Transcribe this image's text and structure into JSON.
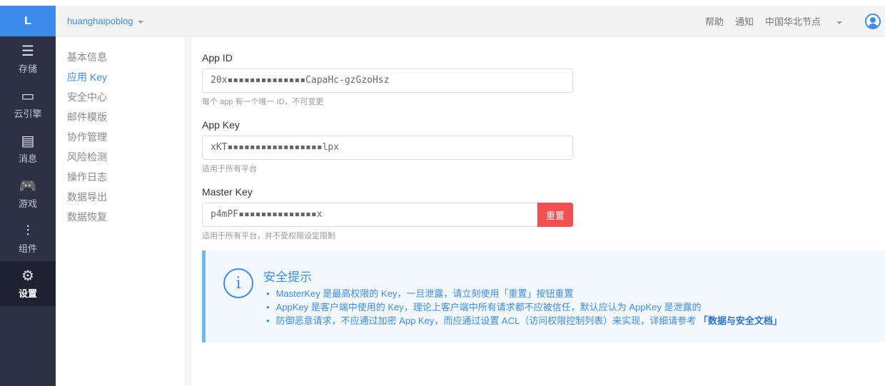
{
  "logo": "L",
  "header": {
    "app_name": "huanghaipoblog",
    "help": "帮助",
    "notify": "通知",
    "region": "中国华北节点"
  },
  "sidebar": [
    {
      "icon": "database-icon",
      "glyph": "☰",
      "label": "存储"
    },
    {
      "icon": "server-icon",
      "glyph": "▭",
      "label": "云引擎"
    },
    {
      "icon": "message-icon",
      "glyph": "▤",
      "label": "消息"
    },
    {
      "icon": "gamepad-icon",
      "glyph": "🎮",
      "label": "游戏"
    },
    {
      "icon": "components-icon",
      "glyph": "⫶",
      "label": "组件"
    },
    {
      "icon": "gear-icon",
      "glyph": "⚙",
      "label": "设置"
    }
  ],
  "subnav": [
    "基本信息",
    "应用 Key",
    "安全中心",
    "邮件模版",
    "协作管理",
    "风险检测",
    "操作日志",
    "数据导出",
    "数据恢复"
  ],
  "form": {
    "app_id": {
      "label": "App ID",
      "value": "20x▪▪▪▪▪▪▪▪▪▪▪▪▪▪CapaHc-gzGzoHsz",
      "hint": "每个 app 有一个唯一 ID，不可变更"
    },
    "app_key": {
      "label": "App Key",
      "value": "xKT▪▪▪▪▪▪▪▪▪▪▪▪▪▪▪▪▪lpx",
      "hint": "适用于所有平台"
    },
    "master_key": {
      "label": "Master Key",
      "value": "p4mPF▪▪▪▪▪▪▪▪▪▪▪▪▪▪x",
      "hint": "适用于所有平台，并不受权限设定限制",
      "reset": "重置"
    }
  },
  "tip": {
    "title": "安全提示",
    "items": [
      "MasterKey 是最高权限的 Key，一旦泄露，请立刻使用「重置」按钮重置",
      "AppKey 是客户端中使用的 Key，理论上客户端中所有请求都不应被信任，默认应认为 AppKey 是泄露的",
      "防御恶意请求，不应通过加密 App Key，而应通过设置 ACL（访问权限控制列表）来实现，详细请参考 "
    ],
    "link": "「数据与安全文档」"
  }
}
